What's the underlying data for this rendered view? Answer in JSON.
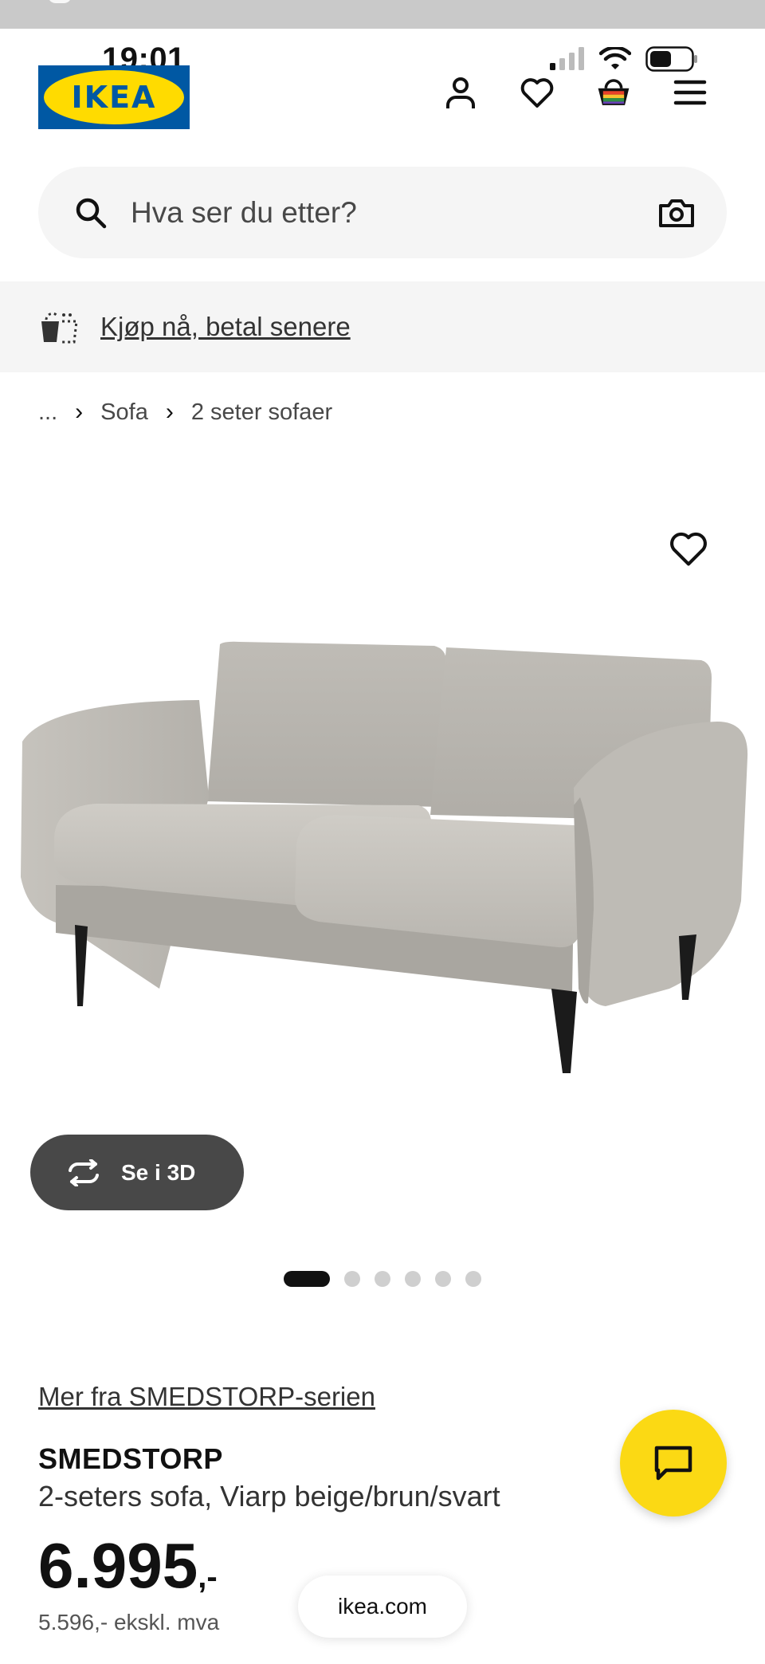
{
  "status_bar": {
    "time": "19:01"
  },
  "header": {
    "logo_text": "IKEA",
    "icons": [
      "user-icon",
      "heart-icon",
      "basket-icon",
      "menu-icon"
    ]
  },
  "search": {
    "placeholder": "Hva ser du etter?"
  },
  "promo": {
    "label": "Kjøp nå, betal senere"
  },
  "breadcrumb": {
    "ellipsis": "...",
    "items": [
      "Sofa",
      "2 seter sofaer"
    ]
  },
  "gallery": {
    "view_3d_label": "Se i 3D",
    "slide_count": 6,
    "active_slide": 1
  },
  "product": {
    "series_link": "Mer fra SMEDSTORP-serien",
    "name": "SMEDSTORP",
    "description": "2-seters sofa, Viarp beige/brun/svart",
    "price": "6.995",
    "price_suffix": ",-",
    "price_ex_vat": "5.596,- ekskl. mva"
  },
  "browser": {
    "url": "ikea.com"
  },
  "colors": {
    "brand_blue": "#0058a3",
    "brand_yellow": "#ffdb00",
    "chat_yellow": "#fbd914",
    "dark_button": "#484848"
  }
}
